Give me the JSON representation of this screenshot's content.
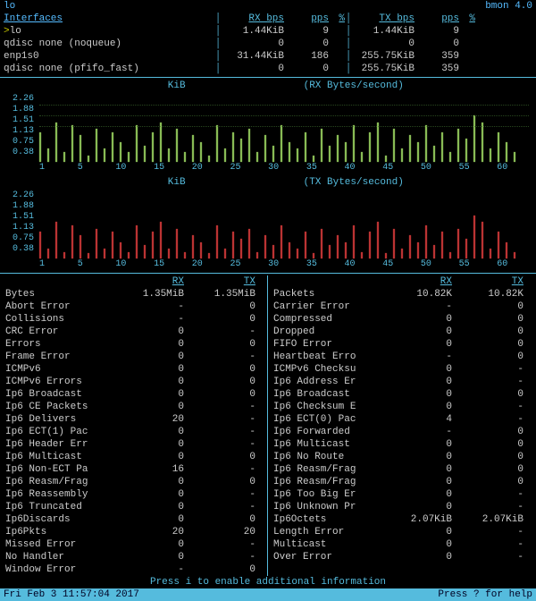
{
  "top": {
    "left": "lo",
    "right": "bmon 4.0"
  },
  "headers": {
    "if": "Interfaces",
    "rx": "RX bps",
    "pps": "pps",
    "pct": "%",
    "tx": "TX bps",
    "sep": "│"
  },
  "ifaces": [
    {
      "mark": ">",
      "name": "lo",
      "rx": "1.44KiB",
      "rxpps": "9",
      "rxpct": "",
      "tx": "1.44KiB",
      "txpps": "9",
      "txpct": ""
    },
    {
      "mark": " ",
      "name": "  qdisc none (noqueue)",
      "rx": "0",
      "rxpps": "0",
      "rxpct": "",
      "tx": "0",
      "txpps": "0",
      "txpct": ""
    },
    {
      "mark": " ",
      "name": "enp1s0",
      "rx": "31.44KiB",
      "rxpps": "186",
      "rxpct": "",
      "tx": "255.75KiB",
      "txpps": "359",
      "txpct": ""
    },
    {
      "mark": " ",
      "name": "  qdisc none (pfifo_fast)",
      "rx": "0",
      "rxpps": "0",
      "rxpct": "",
      "tx": "255.75KiB",
      "txpps": "359",
      "txpct": ""
    }
  ],
  "chart_data": [
    {
      "type": "bar",
      "title": "(RX Bytes/second)",
      "ylabel": "KiB",
      "yticks": [
        "2.26",
        "1.88",
        "1.51",
        "1.13",
        "0.75",
        "0.38"
      ],
      "xticks": [
        "1",
        "5",
        "10",
        "15",
        "20",
        "25",
        "30",
        "35",
        "40",
        "45",
        "50",
        "55",
        "60"
      ],
      "values": [
        45,
        20,
        60,
        15,
        55,
        40,
        10,
        50,
        20,
        45,
        30,
        15,
        55,
        25,
        45,
        60,
        20,
        50,
        15,
        40,
        30,
        10,
        55,
        20,
        45,
        35,
        50,
        15,
        40,
        25,
        55,
        30,
        20,
        45,
        10,
        50,
        25,
        40,
        30,
        55,
        15,
        45,
        60,
        10,
        50,
        20,
        40,
        30,
        55,
        25,
        45,
        15,
        50,
        35,
        70,
        60,
        20,
        45,
        30,
        15
      ]
    },
    {
      "type": "bar",
      "title": "(TX Bytes/second)",
      "ylabel": "KiB",
      "yticks": [
        "2.26",
        "1.88",
        "1.51",
        "1.13",
        "0.75",
        "0.38"
      ],
      "xticks": [
        "1",
        "5",
        "10",
        "15",
        "20",
        "25",
        "30",
        "35",
        "40",
        "45",
        "50",
        "55",
        "60"
      ],
      "values": [
        40,
        15,
        55,
        10,
        50,
        35,
        8,
        45,
        15,
        40,
        25,
        10,
        50,
        20,
        40,
        55,
        15,
        45,
        10,
        35,
        25,
        8,
        50,
        15,
        40,
        30,
        45,
        10,
        35,
        20,
        50,
        25,
        15,
        40,
        8,
        45,
        20,
        35,
        25,
        50,
        10,
        40,
        55,
        8,
        45,
        15,
        35,
        25,
        50,
        20,
        40,
        10,
        45,
        30,
        65,
        55,
        15,
        40,
        25,
        10
      ]
    }
  ],
  "stats_hdr": {
    "rx": "RX",
    "tx": "TX"
  },
  "stats_left": [
    {
      "lab": "Bytes",
      "rx": "1.35MiB",
      "tx": "1.35MiB"
    },
    {
      "lab": "Abort Error",
      "rx": "-",
      "tx": "0"
    },
    {
      "lab": "Collisions",
      "rx": "-",
      "tx": "0"
    },
    {
      "lab": "CRC Error",
      "rx": "0",
      "tx": "-"
    },
    {
      "lab": "Errors",
      "rx": "0",
      "tx": "0"
    },
    {
      "lab": "Frame Error",
      "rx": "0",
      "tx": "-"
    },
    {
      "lab": "ICMPv6",
      "rx": "0",
      "tx": "0"
    },
    {
      "lab": "ICMPv6 Errors",
      "rx": "0",
      "tx": "0"
    },
    {
      "lab": "Ip6 Broadcast",
      "rx": "0",
      "tx": "0"
    },
    {
      "lab": "Ip6 CE Packets",
      "rx": "0",
      "tx": "-"
    },
    {
      "lab": "Ip6 Delivers",
      "rx": "20",
      "tx": "-"
    },
    {
      "lab": "Ip6 ECT(1) Pac",
      "rx": "0",
      "tx": "-"
    },
    {
      "lab": "Ip6 Header Err",
      "rx": "0",
      "tx": "-"
    },
    {
      "lab": "Ip6 Multicast",
      "rx": "0",
      "tx": "0"
    },
    {
      "lab": "Ip6 Non-ECT Pa",
      "rx": "16",
      "tx": "-"
    },
    {
      "lab": "Ip6 Reasm/Frag",
      "rx": "0",
      "tx": "0"
    },
    {
      "lab": "Ip6 Reassembly",
      "rx": "0",
      "tx": "-"
    },
    {
      "lab": "Ip6 Truncated",
      "rx": "0",
      "tx": "-"
    },
    {
      "lab": "Ip6Discards",
      "rx": "0",
      "tx": "0"
    },
    {
      "lab": "Ip6Pkts",
      "rx": "20",
      "tx": "20"
    },
    {
      "lab": "Missed Error",
      "rx": "0",
      "tx": "-"
    },
    {
      "lab": "No Handler",
      "rx": "0",
      "tx": "-"
    },
    {
      "lab": "Window Error",
      "rx": "-",
      "tx": "0"
    }
  ],
  "stats_right": [
    {
      "lab": "Packets",
      "rx": "10.82K",
      "tx": "10.82K"
    },
    {
      "lab": "Carrier Error",
      "rx": "-",
      "tx": "0"
    },
    {
      "lab": "Compressed",
      "rx": "0",
      "tx": "0"
    },
    {
      "lab": "Dropped",
      "rx": "0",
      "tx": "0"
    },
    {
      "lab": "FIFO Error",
      "rx": "0",
      "tx": "0"
    },
    {
      "lab": "Heartbeat Erro",
      "rx": "-",
      "tx": "0"
    },
    {
      "lab": "ICMPv6 Checksu",
      "rx": "0",
      "tx": "-"
    },
    {
      "lab": "Ip6 Address Er",
      "rx": "0",
      "tx": "-"
    },
    {
      "lab": "Ip6 Broadcast",
      "rx": "0",
      "tx": "0"
    },
    {
      "lab": "Ip6 Checksum E",
      "rx": "0",
      "tx": "-"
    },
    {
      "lab": "Ip6 ECT(0) Pac",
      "rx": "4",
      "tx": "-"
    },
    {
      "lab": "Ip6 Forwarded",
      "rx": "-",
      "tx": "0"
    },
    {
      "lab": "Ip6 Multicast",
      "rx": "0",
      "tx": "0"
    },
    {
      "lab": "Ip6 No Route",
      "rx": "0",
      "tx": "0"
    },
    {
      "lab": "Ip6 Reasm/Frag",
      "rx": "0",
      "tx": "0"
    },
    {
      "lab": "Ip6 Reasm/Frag",
      "rx": "0",
      "tx": "0"
    },
    {
      "lab": "Ip6 Too Big Er",
      "rx": "0",
      "tx": "-"
    },
    {
      "lab": "Ip6 Unknown Pr",
      "rx": "0",
      "tx": "-"
    },
    {
      "lab": "Ip6Octets",
      "rx": "2.07KiB",
      "tx": "2.07KiB"
    },
    {
      "lab": "Length Error",
      "rx": "0",
      "tx": "-"
    },
    {
      "lab": "Multicast",
      "rx": "0",
      "tx": "-"
    },
    {
      "lab": "Over Error",
      "rx": "0",
      "tx": "-"
    }
  ],
  "footer1": "Press i to enable additional information",
  "footer2": {
    "left": "Fri Feb  3 11:57:04 2017",
    "right": "Press ? for help"
  }
}
